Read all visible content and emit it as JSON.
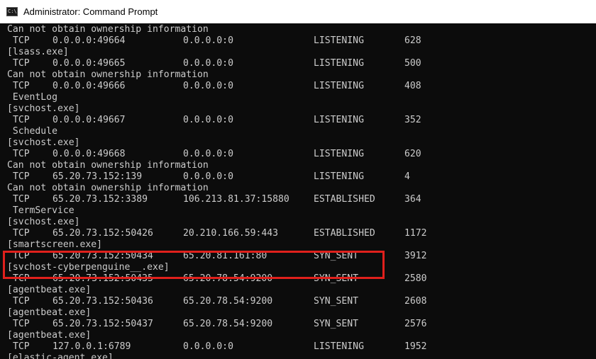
{
  "window": {
    "title": "Administrator: Command Prompt",
    "icon": "cmd-icon",
    "icon_text": "C:\\"
  },
  "colors": {
    "console_bg": "#0c0c0c",
    "console_fg": "#cccccc",
    "highlight": "#e0201c"
  },
  "lines": [
    {
      "type": "text",
      "text": "Can not obtain ownership information"
    },
    {
      "type": "conn",
      "proto": "TCP",
      "local": "0.0.0.0:49664",
      "foreign": "0.0.0.0:0",
      "state": "LISTENING",
      "pid": "628"
    },
    {
      "type": "text",
      "text": "[lsass.exe]"
    },
    {
      "type": "conn",
      "proto": "TCP",
      "local": "0.0.0.0:49665",
      "foreign": "0.0.0.0:0",
      "state": "LISTENING",
      "pid": "500"
    },
    {
      "type": "text",
      "text": "Can not obtain ownership information"
    },
    {
      "type": "conn",
      "proto": "TCP",
      "local": "0.0.0.0:49666",
      "foreign": "0.0.0.0:0",
      "state": "LISTENING",
      "pid": "408"
    },
    {
      "type": "text",
      "text": " EventLog"
    },
    {
      "type": "text",
      "text": "[svchost.exe]"
    },
    {
      "type": "conn",
      "proto": "TCP",
      "local": "0.0.0.0:49667",
      "foreign": "0.0.0.0:0",
      "state": "LISTENING",
      "pid": "352"
    },
    {
      "type": "text",
      "text": " Schedule"
    },
    {
      "type": "text",
      "text": "[svchost.exe]"
    },
    {
      "type": "conn",
      "proto": "TCP",
      "local": "0.0.0.0:49668",
      "foreign": "0.0.0.0:0",
      "state": "LISTENING",
      "pid": "620"
    },
    {
      "type": "text",
      "text": "Can not obtain ownership information"
    },
    {
      "type": "conn",
      "proto": "TCP",
      "local": "65.20.73.152:139",
      "foreign": "0.0.0.0:0",
      "state": "LISTENING",
      "pid": "4"
    },
    {
      "type": "text",
      "text": "Can not obtain ownership information"
    },
    {
      "type": "conn",
      "proto": "TCP",
      "local": "65.20.73.152:3389",
      "foreign": "106.213.81.37:15880",
      "state": "ESTABLISHED",
      "pid": "364"
    },
    {
      "type": "text",
      "text": " TermService"
    },
    {
      "type": "text",
      "text": "[svchost.exe]"
    },
    {
      "type": "conn",
      "proto": "TCP",
      "local": "65.20.73.152:50426",
      "foreign": "20.210.166.59:443",
      "state": "ESTABLISHED",
      "pid": "1172"
    },
    {
      "type": "text",
      "text": "[smartscreen.exe]"
    },
    {
      "type": "conn",
      "proto": "TCP",
      "local": "65.20.73.152:50434",
      "foreign": "65.20.81.161:80",
      "state": "SYN_SENT",
      "pid": "3912"
    },
    {
      "type": "text",
      "text": "[svchost-cyberpenguine__.exe]"
    },
    {
      "type": "conn",
      "proto": "TCP",
      "local": "65.20.73.152:50435",
      "foreign": "65.20.78.54:9200",
      "state": "SYN_SENT",
      "pid": "2580"
    },
    {
      "type": "text",
      "text": "[agentbeat.exe]"
    },
    {
      "type": "conn",
      "proto": "TCP",
      "local": "65.20.73.152:50436",
      "foreign": "65.20.78.54:9200",
      "state": "SYN_SENT",
      "pid": "2608"
    },
    {
      "type": "text",
      "text": "[agentbeat.exe]"
    },
    {
      "type": "conn",
      "proto": "TCP",
      "local": "65.20.73.152:50437",
      "foreign": "65.20.78.54:9200",
      "state": "SYN_SENT",
      "pid": "2576"
    },
    {
      "type": "text",
      "text": "[agentbeat.exe]"
    },
    {
      "type": "conn",
      "proto": "TCP",
      "local": "127.0.0.1:6789",
      "foreign": "0.0.0.0:0",
      "state": "LISTENING",
      "pid": "1952"
    },
    {
      "type": "text",
      "text": "[elastic-agent.exe]"
    }
  ]
}
